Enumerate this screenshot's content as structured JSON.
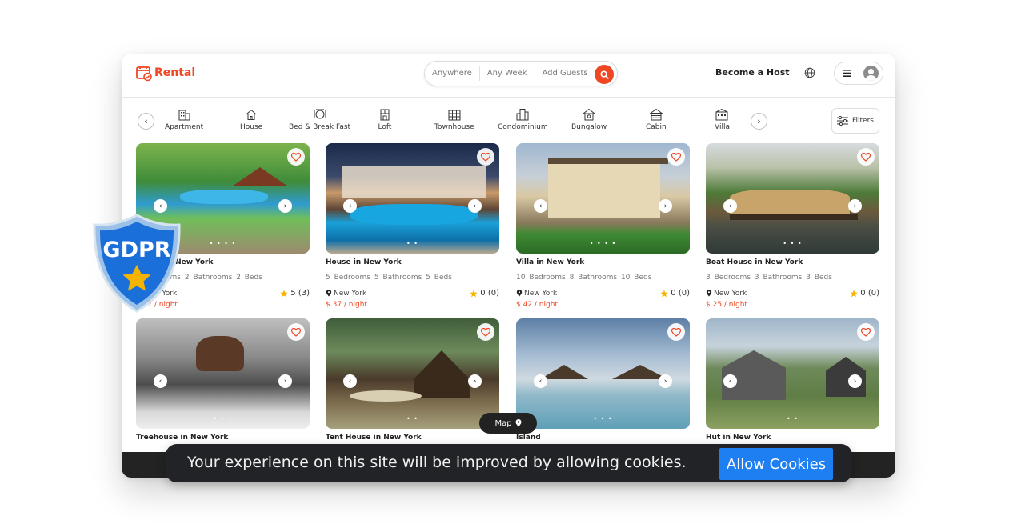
{
  "brand": {
    "name": "Rental",
    "accent": "#ef4723"
  },
  "search": {
    "where": "Anywhere",
    "when": "Any Week",
    "guests": "Add Guests"
  },
  "header": {
    "host_link": "Become a Host"
  },
  "categories": [
    {
      "label": "Apartment",
      "icon": "apartment-icon"
    },
    {
      "label": "House",
      "icon": "house-icon"
    },
    {
      "label": "Bed & Break Fast",
      "icon": "bed-breakfast-icon"
    },
    {
      "label": "Loft",
      "icon": "loft-icon"
    },
    {
      "label": "Townhouse",
      "icon": "townhouse-icon"
    },
    {
      "label": "Condominium",
      "icon": "condominium-icon"
    },
    {
      "label": "Bungalow",
      "icon": "bungalow-icon"
    },
    {
      "label": "Cabin",
      "icon": "cabin-icon"
    },
    {
      "label": "Villa",
      "icon": "villa-icon"
    }
  ],
  "filters_label": "Filters",
  "listings": [
    {
      "title": "Resort in New York",
      "beds": "2 Bedrooms",
      "baths": "2 Bathrooms",
      "bedcount": "2 Beds",
      "location": "New York",
      "rating": "5 (3)",
      "price": "$ 37 / night",
      "dots": "• • • •"
    },
    {
      "title": "House in New York",
      "beds": "5 Bedrooms",
      "baths": "5 Bathrooms",
      "bedcount": "5 Beds",
      "location": "New York",
      "rating": "0 (0)",
      "price": "$ 37 / night",
      "dots": "• •"
    },
    {
      "title": "Villa in New York",
      "beds": "10 Bedrooms",
      "baths": "8 Bathrooms",
      "bedcount": "10 Beds",
      "location": "New York",
      "rating": "0 (0)",
      "price": "$ 42 / night",
      "dots": "• • • •"
    },
    {
      "title": "Boat House in New York",
      "beds": "3 Bedrooms",
      "baths": "3 Bathrooms",
      "bedcount": "3 Beds",
      "location": "New York",
      "rating": "0 (0)",
      "price": "$ 25 / night",
      "dots": "• • •"
    },
    {
      "title": "Treehouse in New York",
      "dots": "• • •"
    },
    {
      "title": "Tent House in New York",
      "dots": "• •"
    },
    {
      "title": "Island",
      "dots": "• • •"
    },
    {
      "title": "Hut in New York",
      "dots": "• •"
    }
  ],
  "map_label": "Map",
  "cookie": {
    "message": "Your experience on this site will be improved by allowing cookies.",
    "button": "Allow Cookies"
  },
  "gdpr_badge": "GDPR",
  "colors": {
    "cookie_button": "#1e7ff2",
    "price": "#ef4723",
    "shield": "#1a6fd8",
    "star": "#f5b400"
  }
}
